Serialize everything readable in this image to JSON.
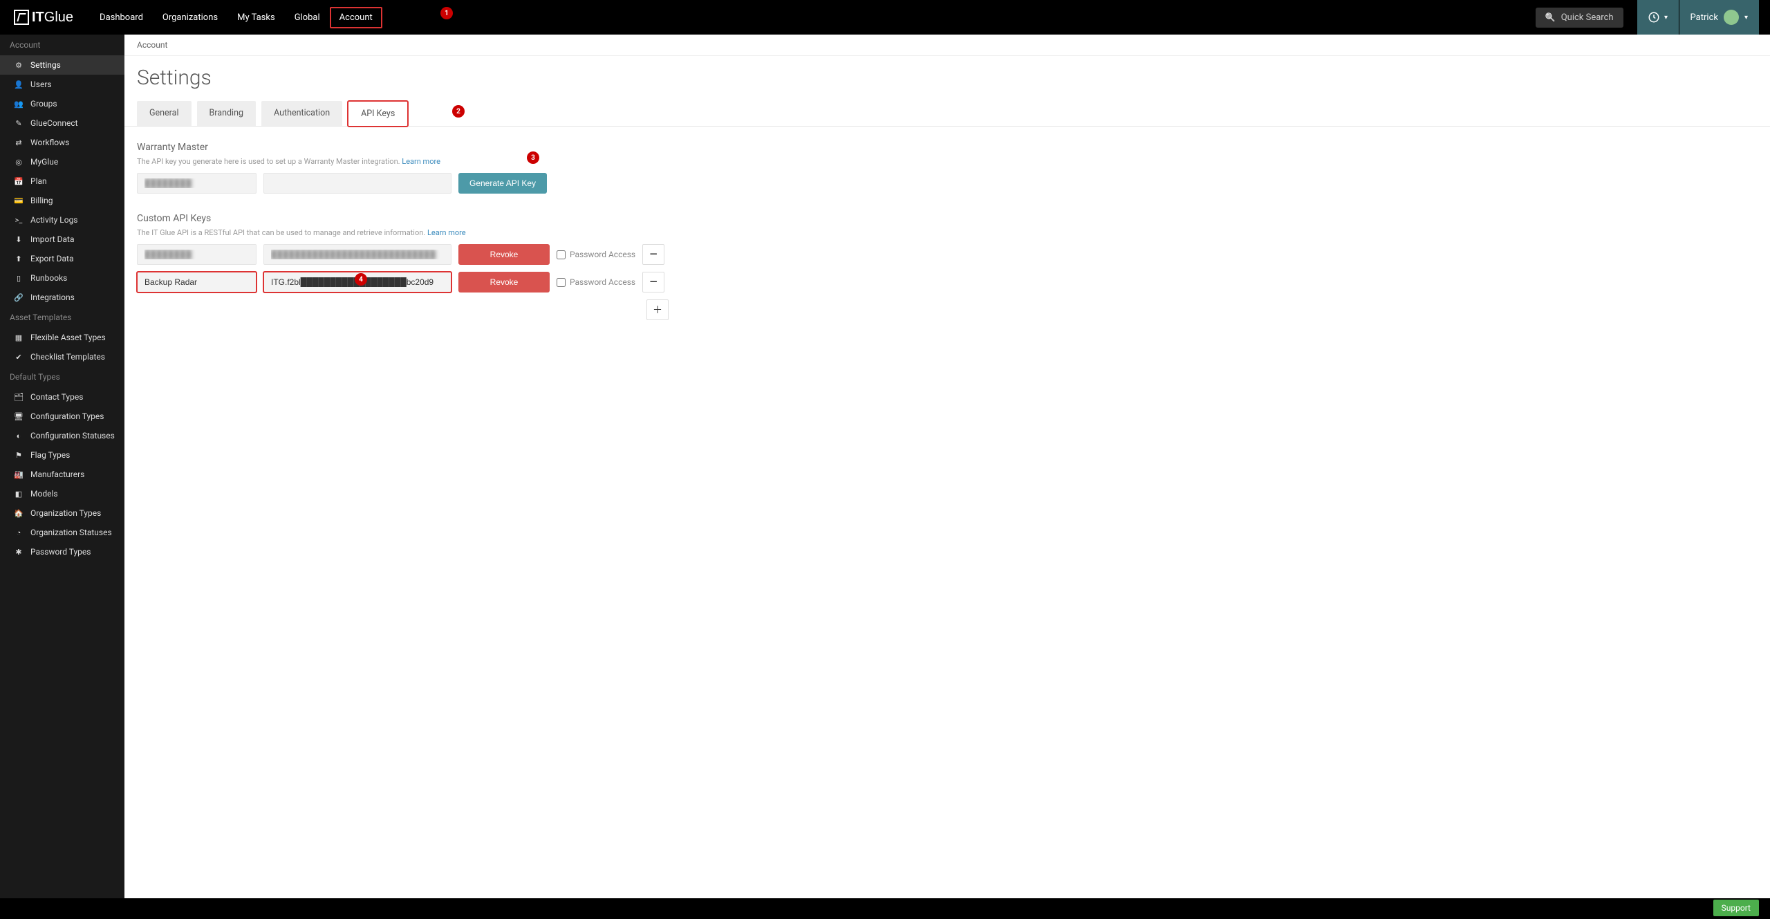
{
  "brand": {
    "it": "IT",
    "glue": "Glue"
  },
  "topnav": {
    "items": [
      {
        "label": "Dashboard"
      },
      {
        "label": "Organizations"
      },
      {
        "label": "My Tasks"
      },
      {
        "label": "Global"
      },
      {
        "label": "Account",
        "highlighted": true
      }
    ],
    "quick_search": "Quick Search",
    "user_name": "Patrick"
  },
  "badges": {
    "b1": "1",
    "b2": "2",
    "b3": "3",
    "b4": "4"
  },
  "sidebar": {
    "groups": [
      {
        "title": "Account",
        "items": [
          {
            "icon": "cog-icon",
            "glyph": "⚙",
            "label": "Settings",
            "active": true
          },
          {
            "icon": "user-icon",
            "glyph": "👤",
            "label": "Users"
          },
          {
            "icon": "users-icon",
            "glyph": "👥",
            "label": "Groups"
          },
          {
            "icon": "plug-icon",
            "glyph": "✎",
            "label": "GlueConnect"
          },
          {
            "icon": "random-icon",
            "glyph": "⇄",
            "label": "Workflows"
          },
          {
            "icon": "globe-icon",
            "glyph": "◎",
            "label": "MyGlue"
          },
          {
            "icon": "calendar-icon",
            "glyph": "📅",
            "label": "Plan"
          },
          {
            "icon": "card-icon",
            "glyph": "💳",
            "label": "Billing"
          },
          {
            "icon": "terminal-icon",
            "glyph": ">_",
            "label": "Activity Logs"
          },
          {
            "icon": "download-icon",
            "glyph": "⬇",
            "label": "Import Data"
          },
          {
            "icon": "upload-icon",
            "glyph": "⬆",
            "label": "Export Data"
          },
          {
            "icon": "file-icon",
            "glyph": "▯",
            "label": "Runbooks"
          },
          {
            "icon": "link-icon",
            "glyph": "🔗",
            "label": "Integrations"
          }
        ]
      },
      {
        "title": "Asset Templates",
        "items": [
          {
            "icon": "table-icon",
            "glyph": "▦",
            "label": "Flexible Asset Types"
          },
          {
            "icon": "check-icon",
            "glyph": "✔",
            "label": "Checklist Templates"
          }
        ]
      },
      {
        "title": "Default Types",
        "items": [
          {
            "icon": "idcard-icon",
            "glyph": "🗂",
            "label": "Contact Types"
          },
          {
            "icon": "desktop-icon",
            "glyph": "🖥",
            "label": "Configuration Types"
          },
          {
            "icon": "status-icon",
            "glyph": "◐",
            "label": "Configuration Statuses"
          },
          {
            "icon": "flag-icon",
            "glyph": "⚑",
            "label": "Flag Types"
          },
          {
            "icon": "factory-icon",
            "glyph": "🏭",
            "label": "Manufacturers"
          },
          {
            "icon": "cube-icon",
            "glyph": "◧",
            "label": "Models"
          },
          {
            "icon": "building-icon",
            "glyph": "🏠",
            "label": "Organization Types"
          },
          {
            "icon": "circle-icon",
            "glyph": "◔",
            "label": "Organization Statuses"
          },
          {
            "icon": "key-icon",
            "glyph": "✱",
            "label": "Password Types"
          }
        ]
      }
    ]
  },
  "breadcrumb": "Account",
  "page_title": "Settings",
  "tabs": [
    {
      "label": "General"
    },
    {
      "label": "Branding"
    },
    {
      "label": "Authentication"
    },
    {
      "label": "API Keys",
      "active": true,
      "highlighted": true
    }
  ],
  "warranty_master": {
    "title": "Warranty Master",
    "desc": "The API key you generate here is used to set up a Warranty Master integration. ",
    "learn_more": "Learn more",
    "name_value": "████████",
    "key_value": "",
    "generate_btn": "Generate API Key"
  },
  "custom_api": {
    "title": "Custom API Keys",
    "desc": "The IT Glue API is a RESTful API that can be used to manage and retrieve information. ",
    "learn_more": "Learn more",
    "password_access_label": "Password Access",
    "revoke_label": "Revoke",
    "rows": [
      {
        "name": "████████",
        "key": "████████████████████████████",
        "name_hl": false,
        "key_hl": false,
        "blurred": true
      },
      {
        "name": "Backup Radar",
        "key": "ITG.f2bl██████████████████bc20d9",
        "name_hl": true,
        "key_hl": true,
        "blurred": false
      }
    ]
  },
  "support_btn": "Support"
}
